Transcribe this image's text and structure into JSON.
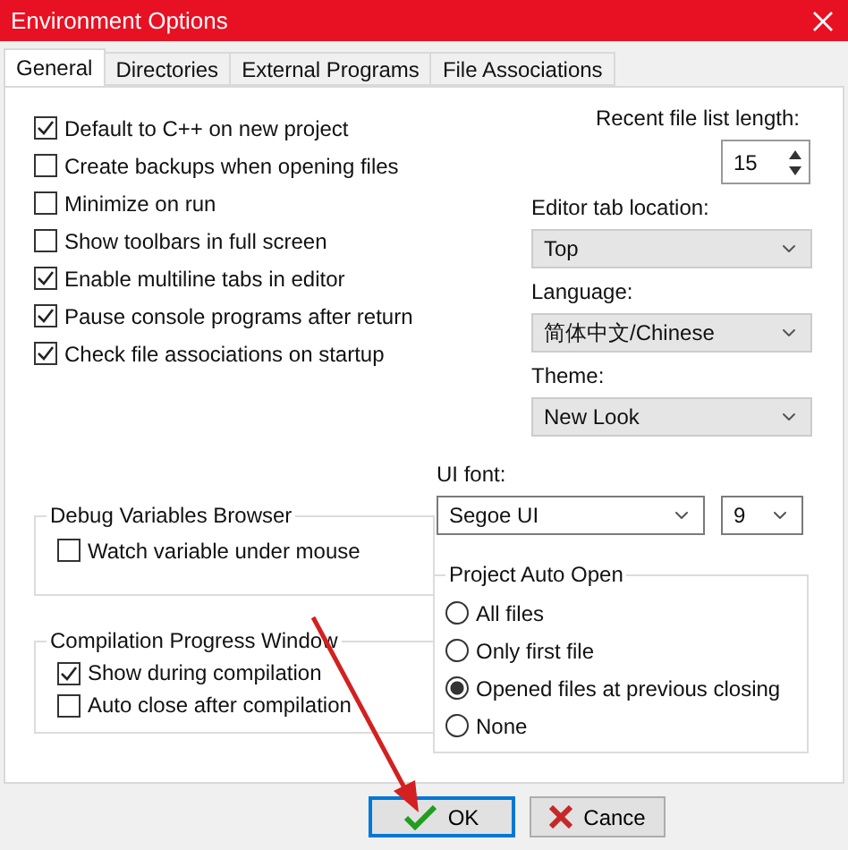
{
  "window": {
    "title": "Environment Options"
  },
  "tabs": [
    {
      "label": "General",
      "selected": true
    },
    {
      "label": "Directories",
      "selected": false
    },
    {
      "label": "External Programs",
      "selected": false
    },
    {
      "label": "File Associations",
      "selected": false
    }
  ],
  "options": [
    {
      "label": "Default to C++ on new project",
      "checked": true
    },
    {
      "label": "Create backups when opening files",
      "checked": false
    },
    {
      "label": "Minimize on run",
      "checked": false
    },
    {
      "label": "Show toolbars in full screen",
      "checked": false
    },
    {
      "label": "Enable multiline tabs in editor",
      "checked": true
    },
    {
      "label": "Pause console programs after return",
      "checked": true
    },
    {
      "label": "Check file associations on startup",
      "checked": true
    }
  ],
  "recent_file_list_length": {
    "label": "Recent file list length:",
    "value": "15"
  },
  "editor_tab_location": {
    "label": "Editor tab location:",
    "value": "Top"
  },
  "language": {
    "label": "Language:",
    "value": "简体中文/Chinese"
  },
  "theme": {
    "label": "Theme:",
    "value": "New Look"
  },
  "ui_font": {
    "label": "UI font:",
    "family": "Segoe UI",
    "size": "9"
  },
  "debug_variables_browser": {
    "title": "Debug Variables Browser",
    "options": [
      {
        "label": "Watch variable under mouse",
        "checked": false
      }
    ]
  },
  "compilation_progress_window": {
    "title": "Compilation Progress Window",
    "options": [
      {
        "label": "Show during compilation",
        "checked": true
      },
      {
        "label": "Auto close after compilation",
        "checked": false
      }
    ]
  },
  "project_auto_open": {
    "title": "Project Auto Open",
    "options": [
      {
        "label": "All files",
        "selected": false
      },
      {
        "label": "Only first file",
        "selected": false
      },
      {
        "label": "Opened files at previous closing",
        "selected": true
      },
      {
        "label": "None",
        "selected": false
      }
    ]
  },
  "buttons": [
    {
      "label": "OK",
      "kind": "ok",
      "focused": true
    },
    {
      "label": "Cance",
      "kind": "cancel",
      "focused": false
    }
  ]
}
